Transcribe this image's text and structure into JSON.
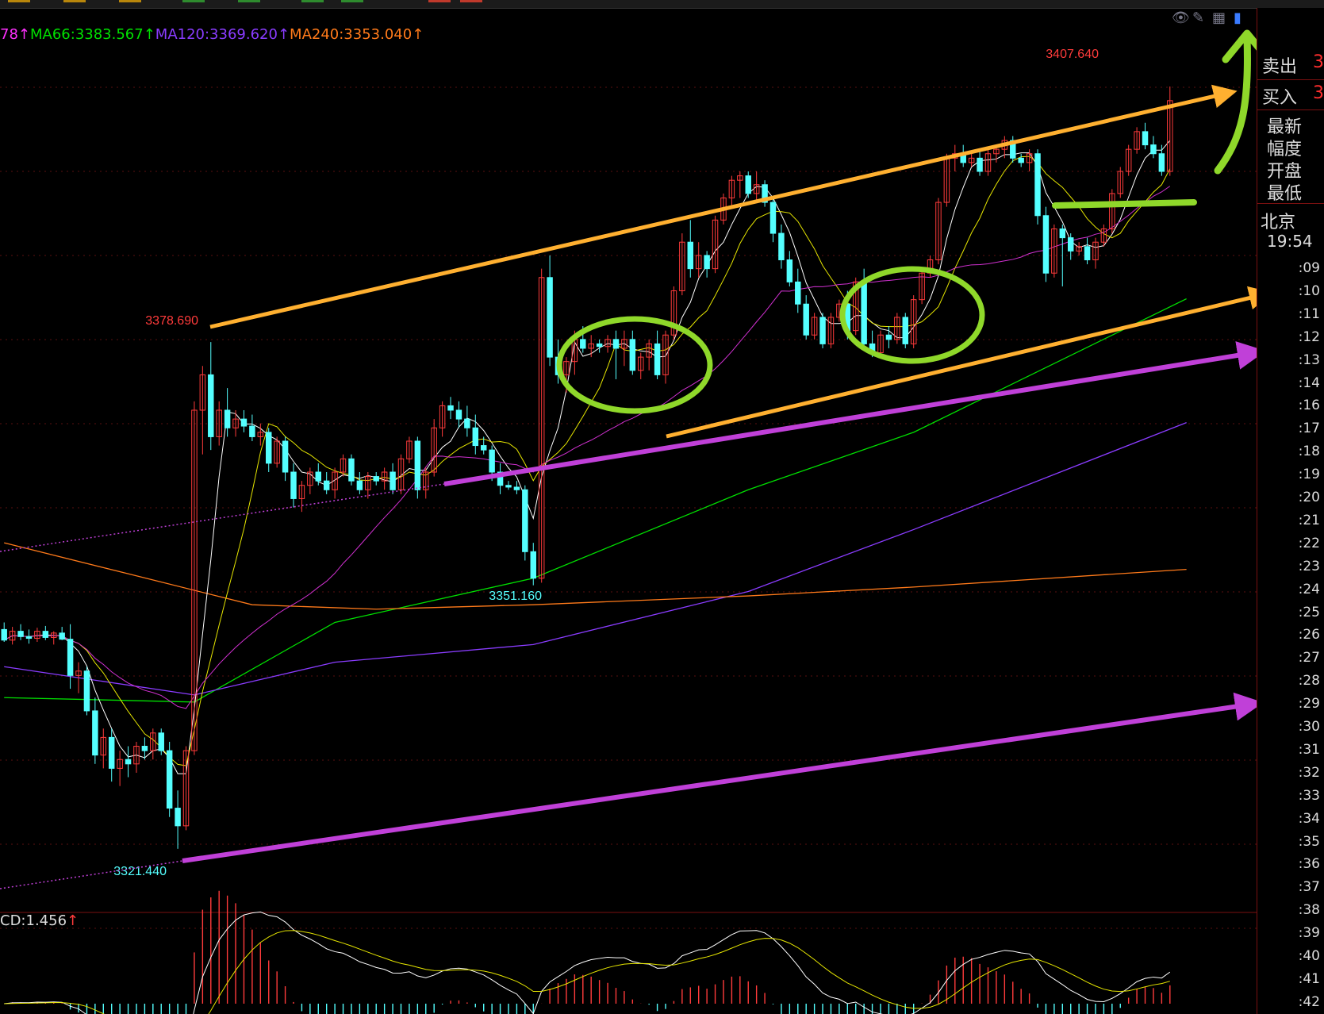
{
  "legend": {
    "ma_prev_tail": "78",
    "ma66_label": "MA66:3383.567",
    "ma120_label": "MA120:3369.620",
    "ma240_label": "MA240:3353.040",
    "arrow": "↑"
  },
  "macd": {
    "label": "CD:1.456",
    "arrow": "↑"
  },
  "annotations": {
    "high_top": "3407.640",
    "high_left": "3378.690",
    "low_mid": "3351.160",
    "low_left": "3321.440"
  },
  "panel": {
    "sell": "卖出",
    "buy": "买入",
    "sell_val": "3",
    "buy_val": "3",
    "latest": "最新",
    "amplitude": "幅度",
    "open": "开盘",
    "lowest": "最低",
    "city": "北京",
    "time": "19:54",
    "minutes": [
      ":09",
      ":10",
      ":11",
      ":12",
      ":13",
      ":14",
      ":16",
      ":17",
      ":18",
      ":19",
      ":20",
      ":21",
      ":22",
      ":23",
      ":24",
      ":25",
      ":26",
      ":27",
      ":28",
      ":29",
      ":30",
      ":31",
      ":32",
      ":33",
      ":34",
      ":35",
      ":36",
      ":37",
      ":38",
      ":39",
      ":40",
      ":41",
      ":42"
    ]
  },
  "colors": {
    "up": "#ff3b3b",
    "down": "#54ffff",
    "ma66": "#00e000",
    "ma120": "#8a3cff",
    "ma240": "#ff7a1a",
    "ma_prev": "#ff30ff",
    "short_ma": "#ffffff",
    "mid_ma": "#e6e600",
    "ma30": "#d030d0",
    "orange_annot": "#ffb030",
    "purple_annot": "#c040d8",
    "green_annot": "#8fd82a"
  },
  "chart_data": {
    "type": "candlestick",
    "ylim": [
      3316,
      3412
    ],
    "candles": [
      [
        3346.2,
        3347.0,
        3344.8,
        3345.0
      ],
      [
        3345.0,
        3346.5,
        3344.5,
        3346.0
      ],
      [
        3346.0,
        3346.8,
        3345.0,
        3345.4
      ],
      [
        3345.4,
        3346.2,
        3344.6,
        3345.2
      ],
      [
        3345.2,
        3346.4,
        3344.8,
        3346.0
      ],
      [
        3346.0,
        3346.6,
        3345.0,
        3345.3
      ],
      [
        3345.3,
        3346.0,
        3344.5,
        3345.8
      ],
      [
        3345.8,
        3346.5,
        3345.0,
        3345.1
      ],
      [
        3345.1,
        3346.8,
        3339.5,
        3341.0
      ],
      [
        3341.0,
        3342.5,
        3339.0,
        3341.5
      ],
      [
        3341.5,
        3342.0,
        3336.5,
        3337.0
      ],
      [
        3337.0,
        3338.5,
        3331.0,
        3332.0
      ],
      [
        3332.0,
        3335.0,
        3330.5,
        3334.0
      ],
      [
        3334.0,
        3335.0,
        3329.0,
        3330.5
      ],
      [
        3330.5,
        3332.5,
        3328.5,
        3331.5
      ],
      [
        3331.5,
        3333.0,
        3329.5,
        3331.0
      ],
      [
        3331.0,
        3333.5,
        3330.0,
        3333.0
      ],
      [
        3333.0,
        3334.0,
        3331.5,
        3332.5
      ],
      [
        3332.5,
        3335.0,
        3331.5,
        3334.5
      ],
      [
        3334.5,
        3335.0,
        3332.0,
        3332.5
      ],
      [
        3332.5,
        3333.5,
        3325.0,
        3326.0
      ],
      [
        3326.0,
        3328.0,
        3321.4,
        3324.0
      ],
      [
        3324.0,
        3333.0,
        3323.5,
        3332.5
      ],
      [
        3332.5,
        3372.0,
        3332.0,
        3371.0
      ],
      [
        3371.0,
        3376.0,
        3366.0,
        3375.0
      ],
      [
        3375.0,
        3378.7,
        3366.5,
        3368.0
      ],
      [
        3368.0,
        3372.0,
        3367.0,
        3371.0
      ],
      [
        3371.0,
        3373.5,
        3368.0,
        3369.0
      ],
      [
        3369.0,
        3371.0,
        3368.0,
        3370.0
      ],
      [
        3370.0,
        3371.0,
        3368.5,
        3369.2
      ],
      [
        3369.2,
        3370.5,
        3367.5,
        3368.0
      ],
      [
        3368.0,
        3369.5,
        3367.0,
        3368.5
      ],
      [
        3368.5,
        3369.0,
        3364.0,
        3365.0
      ],
      [
        3365.0,
        3368.0,
        3364.5,
        3367.5
      ],
      [
        3367.5,
        3368.0,
        3363.0,
        3364.0
      ],
      [
        3364.0,
        3365.0,
        3360.0,
        3361.0
      ],
      [
        3361.0,
        3363.0,
        3359.5,
        3362.5
      ],
      [
        3362.5,
        3364.5,
        3361.5,
        3364.0
      ],
      [
        3364.0,
        3365.0,
        3362.5,
        3363.0
      ],
      [
        3363.0,
        3364.0,
        3361.5,
        3362.0
      ],
      [
        3362.0,
        3364.5,
        3361.0,
        3364.0
      ],
      [
        3364.0,
        3366.0,
        3363.5,
        3365.5
      ],
      [
        3365.5,
        3366.0,
        3362.5,
        3363.0
      ],
      [
        3363.0,
        3364.0,
        3361.5,
        3362.0
      ],
      [
        3362.0,
        3364.0,
        3361.0,
        3363.5
      ],
      [
        3363.5,
        3364.0,
        3362.5,
        3363.0
      ],
      [
        3363.0,
        3364.5,
        3362.0,
        3364.0
      ],
      [
        3364.0,
        3365.0,
        3361.5,
        3362.0
      ],
      [
        3362.0,
        3366.0,
        3361.5,
        3365.5
      ],
      [
        3365.5,
        3368.0,
        3365.0,
        3367.5
      ],
      [
        3367.5,
        3368.0,
        3361.0,
        3362.0
      ],
      [
        3362.0,
        3364.5,
        3361.0,
        3364.0
      ],
      [
        3364.0,
        3370.0,
        3363.5,
        3369.0
      ],
      [
        3369.0,
        3372.0,
        3368.0,
        3371.5
      ],
      [
        3371.5,
        3372.5,
        3370.0,
        3371.0
      ],
      [
        3371.0,
        3372.0,
        3369.0,
        3370.0
      ],
      [
        3370.0,
        3371.5,
        3368.0,
        3369.0
      ],
      [
        3369.0,
        3370.5,
        3366.0,
        3367.0
      ],
      [
        3367.0,
        3368.0,
        3366.0,
        3366.5
      ],
      [
        3366.5,
        3367.0,
        3363.0,
        3364.0
      ],
      [
        3364.0,
        3365.0,
        3361.5,
        3362.5
      ],
      [
        3362.5,
        3363.0,
        3362.0,
        3362.3
      ],
      [
        3362.3,
        3363.0,
        3361.5,
        3362.0
      ],
      [
        3362.0,
        3362.5,
        3354.0,
        3355.0
      ],
      [
        3355.0,
        3356.0,
        3351.2,
        3352.0
      ],
      [
        3352.0,
        3387.0,
        3351.5,
        3386.0
      ],
      [
        3386.0,
        3388.5,
        3376.0,
        3377.0
      ],
      [
        3377.0,
        3379.0,
        3374.0,
        3375.0
      ],
      [
        3375.0,
        3377.0,
        3373.0,
        3376.5
      ],
      [
        3376.5,
        3380.0,
        3375.0,
        3379.0
      ],
      [
        3379.0,
        3380.5,
        3377.5,
        3378.0
      ],
      [
        3378.0,
        3379.5,
        3377.0,
        3378.5
      ],
      [
        3378.5,
        3379.0,
        3377.5,
        3378.2
      ],
      [
        3378.2,
        3379.5,
        3377.5,
        3379.0
      ],
      [
        3379.0,
        3380.0,
        3374.5,
        3378.0
      ],
      [
        3378.0,
        3380.0,
        3376.0,
        3379.0
      ],
      [
        3379.0,
        3380.0,
        3375.0,
        3375.5
      ],
      [
        3375.5,
        3377.5,
        3374.5,
        3377.0
      ],
      [
        3377.0,
        3379.0,
        3375.5,
        3378.5
      ],
      [
        3378.5,
        3380.0,
        3374.5,
        3375.0
      ],
      [
        3375.0,
        3380.0,
        3374.0,
        3379.5
      ],
      [
        3379.5,
        3385.0,
        3379.0,
        3384.5
      ],
      [
        3384.5,
        3391.0,
        3384.0,
        3390.0
      ],
      [
        3390.0,
        3392.5,
        3386.0,
        3387.0
      ],
      [
        3387.0,
        3390.0,
        3386.0,
        3388.5
      ],
      [
        3388.5,
        3389.0,
        3386.0,
        3387.0
      ],
      [
        3387.0,
        3393.0,
        3386.5,
        3392.5
      ],
      [
        3392.5,
        3395.5,
        3392.0,
        3395.0
      ],
      [
        3395.0,
        3397.5,
        3394.0,
        3397.0
      ],
      [
        3397.0,
        3398.0,
        3395.0,
        3397.5
      ],
      [
        3397.5,
        3398.0,
        3395.0,
        3395.5
      ],
      [
        3395.5,
        3398.0,
        3394.5,
        3396.5
      ],
      [
        3396.5,
        3397.0,
        3394.0,
        3394.5
      ],
      [
        3394.5,
        3395.0,
        3390.0,
        3391.0
      ],
      [
        3391.0,
        3392.0,
        3387.0,
        3388.0
      ],
      [
        3388.0,
        3389.0,
        3385.0,
        3385.5
      ],
      [
        3385.5,
        3387.0,
        3382.0,
        3383.0
      ],
      [
        3383.0,
        3384.0,
        3379.0,
        3379.5
      ],
      [
        3379.5,
        3382.0,
        3379.0,
        3381.5
      ],
      [
        3381.5,
        3382.0,
        3378.0,
        3378.5
      ],
      [
        3378.5,
        3382.0,
        3378.0,
        3381.5
      ],
      [
        3381.5,
        3383.5,
        3381.0,
        3383.0
      ],
      [
        3383.0,
        3384.5,
        3379.0,
        3380.0
      ],
      [
        3380.0,
        3386.0,
        3379.5,
        3385.5
      ],
      [
        3385.5,
        3387.0,
        3378.0,
        3378.5
      ],
      [
        3378.5,
        3380.0,
        3377.0,
        3377.5
      ],
      [
        3377.5,
        3380.0,
        3377.0,
        3379.5
      ],
      [
        3379.5,
        3380.5,
        3378.0,
        3379.0
      ],
      [
        3379.0,
        3382.0,
        3378.5,
        3381.5
      ],
      [
        3381.5,
        3382.0,
        3378.0,
        3378.5
      ],
      [
        3378.5,
        3384.0,
        3378.0,
        3383.5
      ],
      [
        3383.5,
        3387.0,
        3383.0,
        3386.5
      ],
      [
        3386.5,
        3388.5,
        3386.0,
        3388.0
      ],
      [
        3388.0,
        3395.0,
        3387.5,
        3394.5
      ],
      [
        3394.5,
        3400.0,
        3394.0,
        3399.5
      ],
      [
        3399.5,
        3401.0,
        3398.0,
        3400.0
      ],
      [
        3400.0,
        3401.0,
        3398.5,
        3399.0
      ],
      [
        3399.0,
        3400.0,
        3398.5,
        3399.5
      ],
      [
        3399.5,
        3400.5,
        3397.5,
        3398.0
      ],
      [
        3398.0,
        3400.5,
        3397.5,
        3400.0
      ],
      [
        3400.0,
        3401.0,
        3399.0,
        3400.5
      ],
      [
        3400.5,
        3402.0,
        3399.5,
        3401.5
      ],
      [
        3401.5,
        3402.0,
        3399.0,
        3399.5
      ],
      [
        3399.5,
        3400.0,
        3398.5,
        3399.0
      ],
      [
        3399.0,
        3400.5,
        3398.0,
        3400.0
      ],
      [
        3400.0,
        3400.5,
        3392.0,
        3393.0
      ],
      [
        3393.0,
        3394.0,
        3385.5,
        3386.5
      ],
      [
        3386.5,
        3392.0,
        3386.0,
        3391.5
      ],
      [
        3391.5,
        3392.0,
        3385.0,
        3390.5
      ],
      [
        3390.5,
        3391.0,
        3388.0,
        3389.0
      ],
      [
        3389.0,
        3390.0,
        3388.5,
        3389.5
      ],
      [
        3389.5,
        3390.5,
        3387.5,
        3388.0
      ],
      [
        3388.0,
        3390.5,
        3387.0,
        3390.0
      ],
      [
        3390.0,
        3392.0,
        3389.5,
        3391.5
      ],
      [
        3391.5,
        3396.0,
        3391.0,
        3395.5
      ],
      [
        3395.5,
        3398.5,
        3395.0,
        3398.0
      ],
      [
        3398.0,
        3401.0,
        3397.5,
        3400.5
      ],
      [
        3400.5,
        3403.0,
        3400.0,
        3402.5
      ],
      [
        3402.5,
        3403.5,
        3400.5,
        3401.0
      ],
      [
        3401.0,
        3402.0,
        3399.5,
        3400.0
      ],
      [
        3400.0,
        3401.0,
        3397.5,
        3398.0
      ],
      [
        3398.0,
        3407.6,
        3397.5,
        3406.0
      ]
    ],
    "ma_lines": [
      {
        "name": "MA66",
        "values": [
          [
            0,
            3338.5
          ],
          [
            23,
            3338.0
          ],
          [
            40,
            3347.0
          ],
          [
            64,
            3352.0
          ],
          [
            90,
            3362.0
          ],
          [
            110,
            3368.5
          ],
          [
            143,
            3383.6
          ]
        ]
      },
      {
        "name": "MA120",
        "values": [
          [
            0,
            3342.0
          ],
          [
            23,
            3338.8
          ],
          [
            40,
            3342.5
          ],
          [
            64,
            3344.5
          ],
          [
            90,
            3350.5
          ],
          [
            110,
            3357.5
          ],
          [
            143,
            3369.6
          ]
        ]
      },
      {
        "name": "MA240",
        "values": [
          [
            0,
            3356.0
          ],
          [
            15,
            3352.5
          ],
          [
            30,
            3349.0
          ],
          [
            45,
            3348.5
          ],
          [
            64,
            3349.0
          ],
          [
            90,
            3350.0
          ],
          [
            110,
            3351.0
          ],
          [
            143,
            3353.0
          ]
        ]
      }
    ],
    "price_labels": [
      {
        "text": "3407.640",
        "idx": 143,
        "price": 3407.64
      },
      {
        "text": "3378.690",
        "idx": 25,
        "price": 3378.69
      },
      {
        "text": "3351.160",
        "idx": 64,
        "price": 3351.16
      },
      {
        "text": "3321.440",
        "idx": 21,
        "price": 3321.44
      }
    ]
  }
}
